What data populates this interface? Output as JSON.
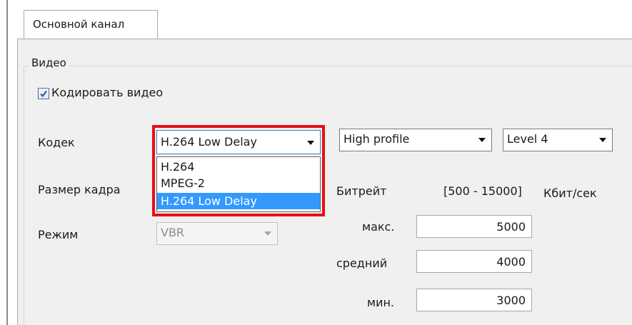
{
  "tabs": [
    {
      "label": "Основной канал",
      "active": true
    }
  ],
  "video_group": {
    "title": "Видео",
    "encode_checkbox": {
      "label": "Кодировать видео",
      "checked": true
    }
  },
  "codec": {
    "label": "Кодек",
    "selected": "H.264 Low Delay",
    "options": [
      "H.264",
      "MPEG-2",
      "H.264 Low Delay"
    ],
    "profile": "High profile",
    "level": "Level 4"
  },
  "frame_size": {
    "label": "Размер кадра"
  },
  "mode": {
    "label": "Режим",
    "value": "VBR"
  },
  "bitrate": {
    "label": "Битрейт",
    "range": "[500 - 15000]",
    "unit": "Кбит/сек",
    "max": {
      "label": "макс.",
      "value": "5000"
    },
    "avg": {
      "label": "средний",
      "value": "4000"
    },
    "min": {
      "label": "мин.",
      "value": "3000"
    }
  },
  "colors": {
    "highlight": "#e3101b",
    "selection": "#3399ff"
  }
}
